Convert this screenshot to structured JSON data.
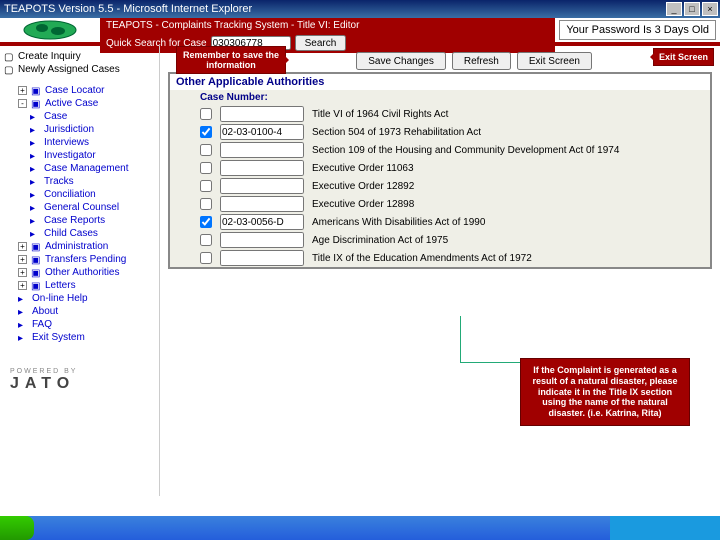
{
  "window": {
    "title": "TEAPOTS Version 5.5 - Microsoft Internet Explorer"
  },
  "header": {
    "system_title": "TEAPOTS - Complaints Tracking System - Title VI: Editor",
    "search_label": "Quick Search for Case",
    "search_value": "030306778",
    "search_btn": "Search",
    "password_msg": "Your Password Is 3 Days Old"
  },
  "sidebar": {
    "top": [
      {
        "label": "Create Inquiry"
      },
      {
        "label": "Newly Assigned Cases"
      }
    ],
    "tree": [
      {
        "label": "Case Locator",
        "plus": true
      },
      {
        "label": "Active Case",
        "plus": true,
        "children": [
          "Case",
          "Jurisdiction",
          "Interviews",
          "Investigator",
          "Case Management",
          "Tracks",
          "Conciliation",
          "General Counsel",
          "Case Reports",
          "Child Cases"
        ]
      },
      {
        "label": "Administration",
        "plus": true
      },
      {
        "label": "Transfers Pending",
        "plus": true
      },
      {
        "label": "Other Authorities",
        "plus": true
      },
      {
        "label": "Letters",
        "plus": true
      }
    ],
    "links": [
      "On-line Help",
      "About",
      "FAQ",
      "Exit System"
    ],
    "powered": "POWERED BY",
    "jato": "JATO"
  },
  "toolbar": {
    "save": "Save Changes",
    "refresh": "Refresh",
    "exit": "Exit Screen"
  },
  "callouts": {
    "remember": "Remember to save the information",
    "exit": "Exit Screen",
    "disaster": "If the Complaint is generated as a result of a natural disaster, please indicate it in the Title IX section using the name of the natural disaster. (i.e. Katrina, Rita)"
  },
  "panel": {
    "title": "Other Applicable Authorities",
    "subtitle": "Case Number:",
    "rows": [
      {
        "checked": false,
        "value": "",
        "label": "Title VI of 1964 Civil Rights Act"
      },
      {
        "checked": true,
        "value": "02-03-0100-4",
        "label": "Section 504 of 1973 Rehabilitation Act"
      },
      {
        "checked": false,
        "value": "",
        "label": "Section 109 of the Housing and Community Development Act 0f 1974"
      },
      {
        "checked": false,
        "value": "",
        "label": "Executive Order 11063"
      },
      {
        "checked": false,
        "value": "",
        "label": "Executive Order 12892"
      },
      {
        "checked": false,
        "value": "",
        "label": "Executive Order 12898"
      },
      {
        "checked": true,
        "value": "02-03-0056-D",
        "label": "Americans With Disabilities Act of 1990"
      },
      {
        "checked": false,
        "value": "",
        "label": "Age Discrimination Act of 1975"
      },
      {
        "checked": false,
        "value": "",
        "label": "Title IX of the Education Amendments Act of 1972"
      }
    ]
  }
}
